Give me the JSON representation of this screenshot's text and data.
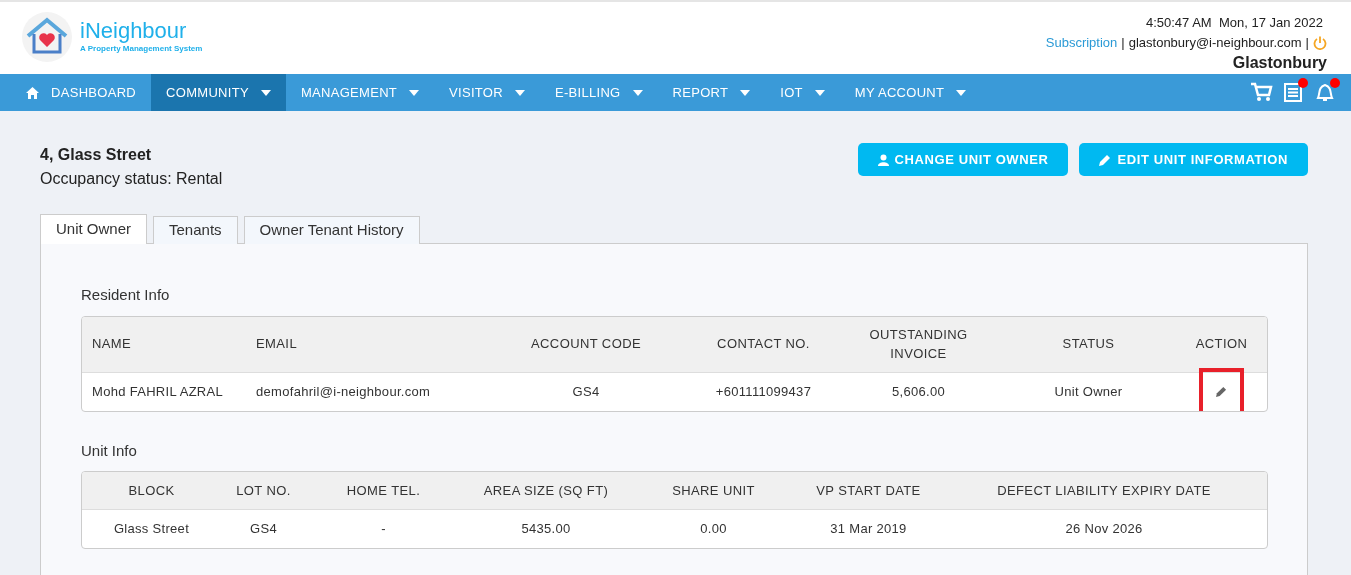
{
  "header": {
    "brand": "iNeighbour",
    "tagline": "A Property Management System",
    "datetime": "4:50:47 AM  Mon, 17 Jan 2022",
    "subscription_link": "Subscription",
    "separator": "|",
    "email": "glastonbury@i-neighbour.com",
    "community_name": "Glastonbury"
  },
  "nav": [
    {
      "label": "DASHBOARD",
      "kind": "home",
      "selected": false
    },
    {
      "label": "COMMUNITY",
      "kind": "dropdown",
      "selected": true
    },
    {
      "label": "MANAGEMENT",
      "kind": "dropdown",
      "selected": false
    },
    {
      "label": "VISITOR",
      "kind": "dropdown",
      "selected": false
    },
    {
      "label": "E-BILLING",
      "kind": "dropdown",
      "selected": false
    },
    {
      "label": "REPORT",
      "kind": "dropdown",
      "selected": false
    },
    {
      "label": "IOT",
      "kind": "dropdown",
      "selected": false
    },
    {
      "label": "MY ACCOUNT",
      "kind": "dropdown",
      "selected": false
    }
  ],
  "nav_icons": [
    {
      "kind": "cart",
      "badge": false
    },
    {
      "kind": "list",
      "badge": true
    },
    {
      "kind": "bell",
      "badge": true
    }
  ],
  "unit": {
    "title": "4, Glass Street",
    "occupancy": "Occupancy status: Rental"
  },
  "actions": [
    {
      "label": "CHANGE UNIT OWNER",
      "kind": "user"
    },
    {
      "label": "EDIT UNIT INFORMATION",
      "kind": "pencil"
    }
  ],
  "tabs": [
    {
      "label": "Unit Owner",
      "selected": true
    },
    {
      "label": "Tenants",
      "selected": false
    },
    {
      "label": "Owner Tenant History",
      "selected": false
    }
  ],
  "resident_info": {
    "heading": "Resident Info",
    "columns": [
      "NAME",
      "EMAIL",
      "ACCOUNT CODE",
      "CONTACT NO.",
      "OUTSTANDING INVOICE",
      "STATUS",
      "ACTION"
    ],
    "rows": [
      {
        "cells": [
          "Mohd FAHRIL AZRAL",
          "demofahril@i-neighbour.com",
          "GS4",
          "+601111099437",
          "5,606.00",
          "Unit Owner"
        ],
        "action_highlighted": true
      }
    ]
  },
  "unit_info": {
    "heading": "Unit Info",
    "columns": [
      "BLOCK",
      "LOT NO.",
      "HOME TEL.",
      "AREA SIZE (SQ FT)",
      "SHARE UNIT",
      "VP START DATE",
      "DEFECT LIABILITY EXPIRY DATE"
    ],
    "rows": [
      [
        "Glass Street",
        "GS4",
        "-",
        "5435.00",
        "0.00",
        "31 Mar 2019",
        "26 Nov 2026"
      ]
    ]
  }
}
